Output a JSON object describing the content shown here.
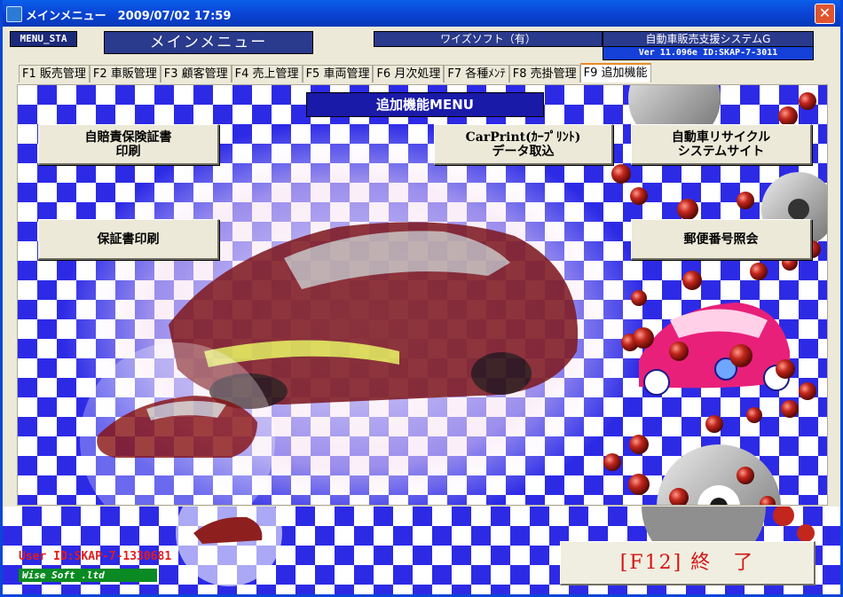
{
  "window": {
    "title": "メインメニュー　2009/07/02 17:59"
  },
  "header": {
    "menu_sta": "MENU_STA",
    "main_title": "メインメニュー",
    "company": "ワイズソフト（有）",
    "system_name": "自動車販売支援システムG",
    "version": "Ver 11.096e   ID:SKAP-7-3011"
  },
  "tabs": [
    {
      "label": "F1 販売管理",
      "active": false
    },
    {
      "label": "F2 車販管理",
      "active": false
    },
    {
      "label": "F3 顧客管理",
      "active": false
    },
    {
      "label": "F4 売上管理",
      "active": false
    },
    {
      "label": "F5 車両管理",
      "active": false
    },
    {
      "label": "F6 月次処理",
      "active": false
    },
    {
      "label": "F7 各種ﾒﾝﾃ",
      "active": false
    },
    {
      "label": "F8 売掛管理",
      "active": false
    },
    {
      "label": "F9 追加機能",
      "active": true
    }
  ],
  "main": {
    "section_title": "追加機能MENU",
    "buttons": {
      "jibaiseki": "自賠責保険証書\n印刷",
      "carprint": "CarPrint(ｶｰﾌﾟﾘﾝﾄ)\nデータ取込",
      "recycle": "自動車リサイクル\nシステムサイト",
      "hoshosho": "保証書印刷",
      "yubin": "郵便番号照会"
    }
  },
  "footer": {
    "user_id": "User ID:SKAP-7-1330681",
    "company_badge": "Wise Soft .ltd",
    "end_button": "[F12]  終　了"
  },
  "colors": {
    "checker": "#2d2ae6",
    "titlebar": "#0a46d8",
    "section_title_bg": "#1a1aa8",
    "end_text": "#d41414",
    "user_id": "#e31c1c",
    "badge": "#0a8a22"
  }
}
